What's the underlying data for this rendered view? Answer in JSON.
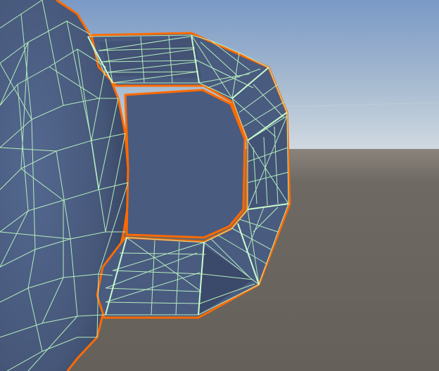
{
  "scene": {
    "view": "3d-scene-viewport",
    "object": "teapot-mesh",
    "selected": true,
    "shading_mode": "shaded-wireframe",
    "colors": {
      "sky_top": "#7d9cc8",
      "sky_horizon": "#c9d5df",
      "ground": "#6b6560",
      "mesh_fill": "#4f6186",
      "mesh_dark": "#34405c",
      "wireframe": "#b9f5c0",
      "selection_outline": "#ff6a00"
    }
  }
}
